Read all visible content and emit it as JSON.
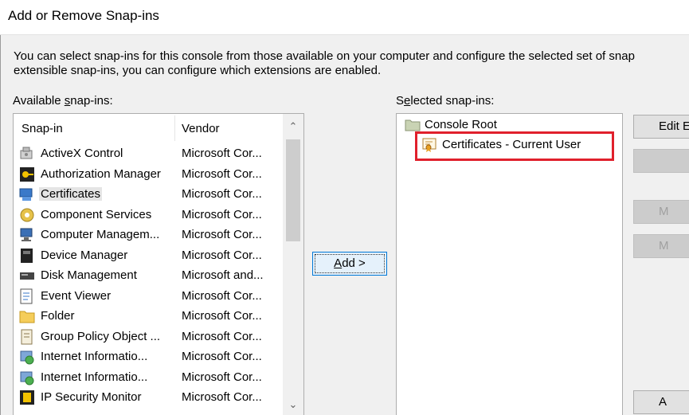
{
  "window": {
    "title": "Add or Remove Snap-ins"
  },
  "intro_line1": "You can select snap-ins for this console from those available on your computer and configure the selected set of snap",
  "intro_line2": "extensible snap-ins, you can configure which extensions are enabled.",
  "available": {
    "label_pre": "Available ",
    "label_u": "s",
    "label_post": "nap-ins:",
    "headers": {
      "snapin": "Snap-in",
      "vendor": "Vendor"
    },
    "rows": [
      {
        "name": "ActiveX Control",
        "vendor": "Microsoft Cor...",
        "icon": "activex-icon"
      },
      {
        "name": "Authorization Manager",
        "vendor": "Microsoft Cor...",
        "icon": "authorization-icon"
      },
      {
        "name": "Certificates",
        "vendor": "Microsoft Cor...",
        "icon": "certificates-icon",
        "selected": true
      },
      {
        "name": "Component Services",
        "vendor": "Microsoft Cor...",
        "icon": "component-services-icon"
      },
      {
        "name": "Computer Managem...",
        "vendor": "Microsoft Cor...",
        "icon": "computer-management-icon"
      },
      {
        "name": "Device Manager",
        "vendor": "Microsoft Cor...",
        "icon": "device-manager-icon"
      },
      {
        "name": "Disk Management",
        "vendor": "Microsoft and...",
        "icon": "disk-management-icon"
      },
      {
        "name": "Event Viewer",
        "vendor": "Microsoft Cor...",
        "icon": "event-viewer-icon"
      },
      {
        "name": "Folder",
        "vendor": "Microsoft Cor...",
        "icon": "folder-icon"
      },
      {
        "name": "Group Policy Object ...",
        "vendor": "Microsoft Cor...",
        "icon": "group-policy-icon"
      },
      {
        "name": "Internet Informatio...",
        "vendor": "Microsoft Cor...",
        "icon": "iis-icon"
      },
      {
        "name": "Internet Informatio...",
        "vendor": "Microsoft Cor...",
        "icon": "iis-icon"
      },
      {
        "name": "IP Security Monitor",
        "vendor": "Microsoft Cor...",
        "icon": "ip-security-icon"
      }
    ]
  },
  "add_button": {
    "underlined": "A",
    "rest": "dd >"
  },
  "selected": {
    "label_pre": "S",
    "label_u": "e",
    "label_post": "lected snap-ins:",
    "root": "Console Root",
    "child": "Certificates - Current User"
  },
  "right_buttons": {
    "edit": "Edit E",
    "b2": "",
    "b3": "M",
    "b4": "M",
    "b5": "A"
  },
  "colors": {
    "highlight": "#e0202c",
    "accent": "#0078d7"
  }
}
